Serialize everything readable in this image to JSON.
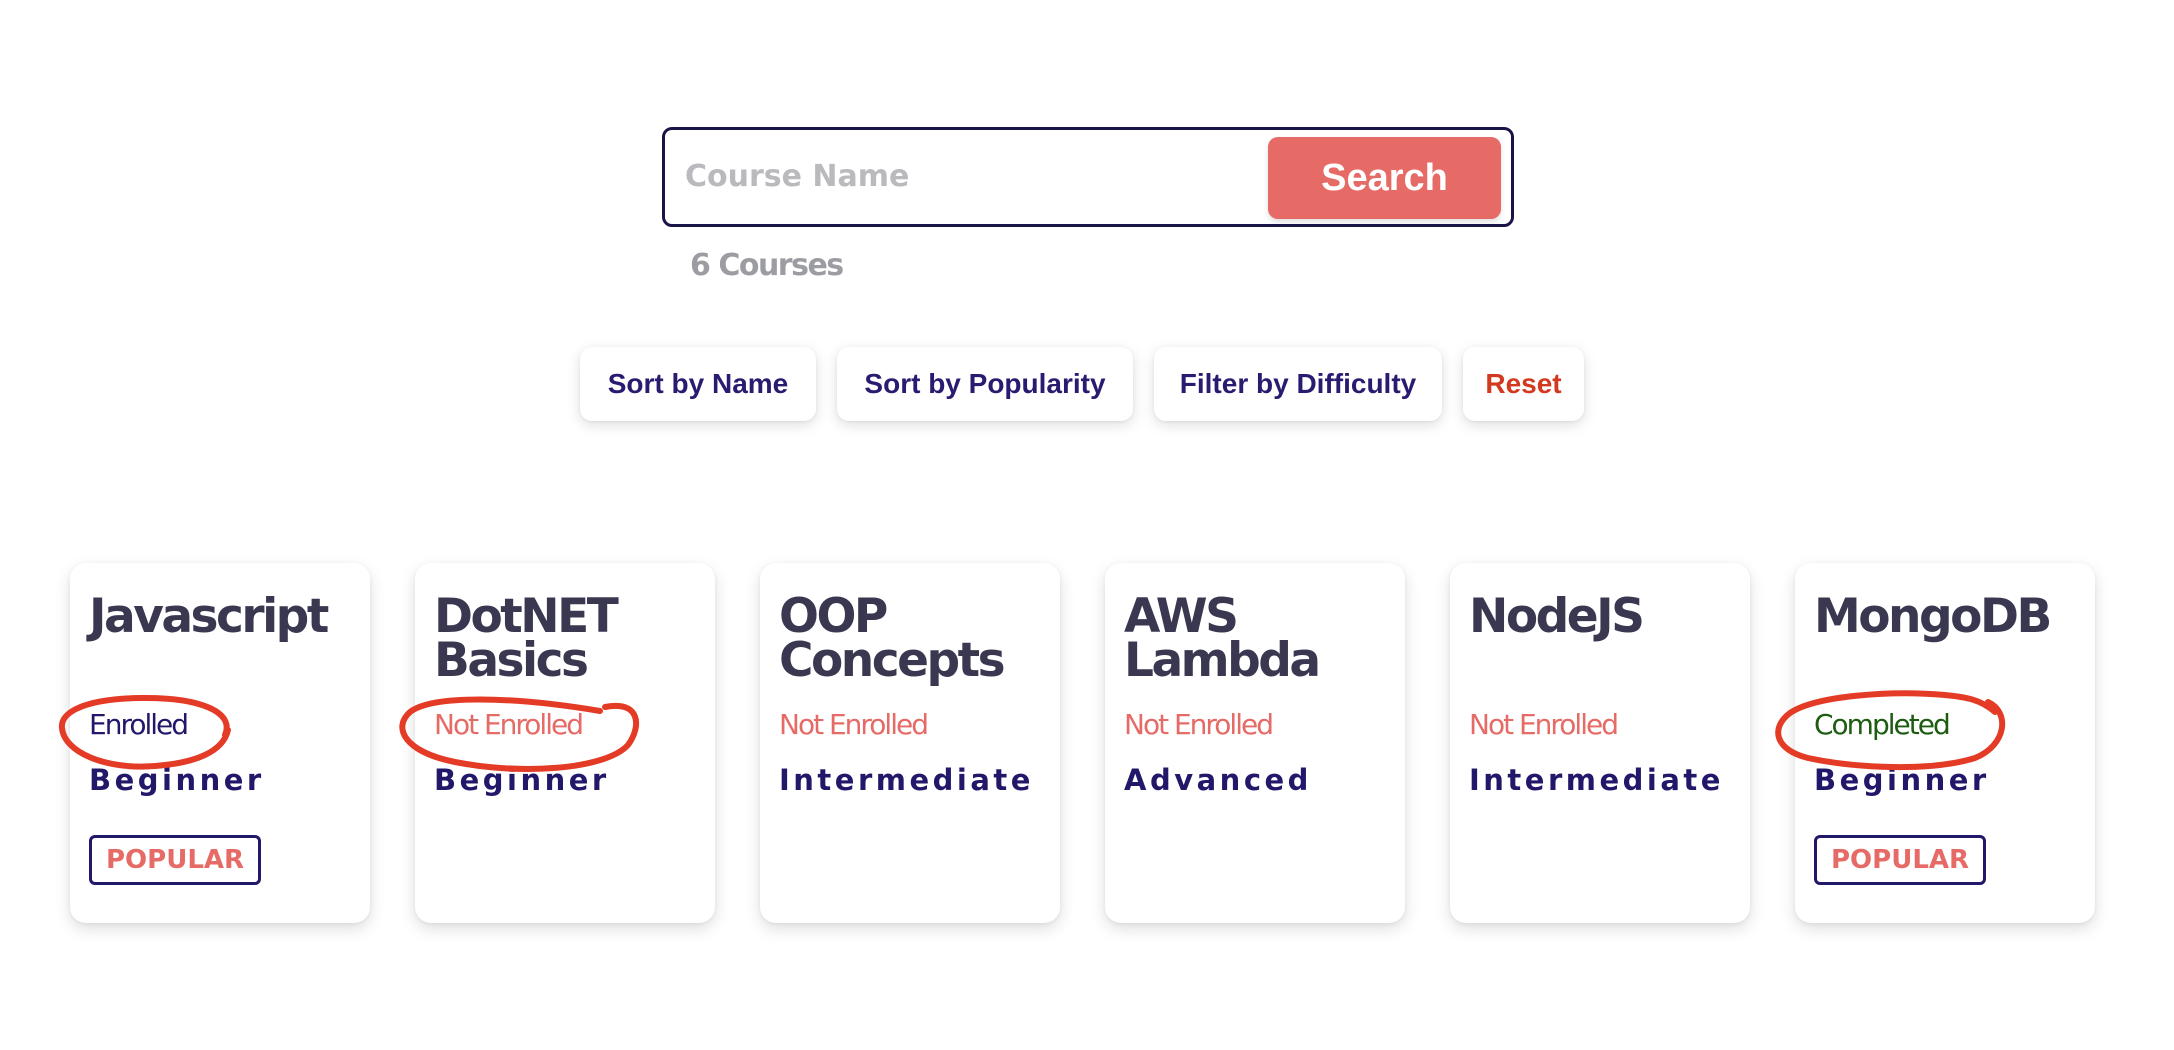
{
  "search": {
    "placeholder": "Course Name",
    "button_label": "Search",
    "result_count": "6 Courses"
  },
  "toolbar": {
    "sort_name": "Sort by Name",
    "sort_popularity": "Sort by Popularity",
    "filter_difficulty": "Filter by Difficulty",
    "reset": "Reset"
  },
  "colors": {
    "accent": "#e66a66",
    "primary": "#22186a",
    "enrolled": "#22186a",
    "not_enrolled": "#e66a66",
    "completed": "#1e5c12",
    "annotation": "#e43b26"
  },
  "courses": [
    {
      "title": "Javascript",
      "status": "Enrolled",
      "level": "Beginner",
      "badge": "POPULAR"
    },
    {
      "title": "DotNET Basics",
      "status": "Not Enrolled",
      "level": "Beginner",
      "badge": ""
    },
    {
      "title": "OOP Concepts",
      "status": "Not Enrolled",
      "level": "Intermediate",
      "badge": ""
    },
    {
      "title": "AWS Lambda",
      "status": "Not Enrolled",
      "level": "Advanced",
      "badge": ""
    },
    {
      "title": "NodeJS",
      "status": "Not Enrolled",
      "level": "Intermediate",
      "badge": ""
    },
    {
      "title": "MongoDB",
      "status": "Completed",
      "level": "Beginner",
      "badge": "POPULAR"
    }
  ]
}
